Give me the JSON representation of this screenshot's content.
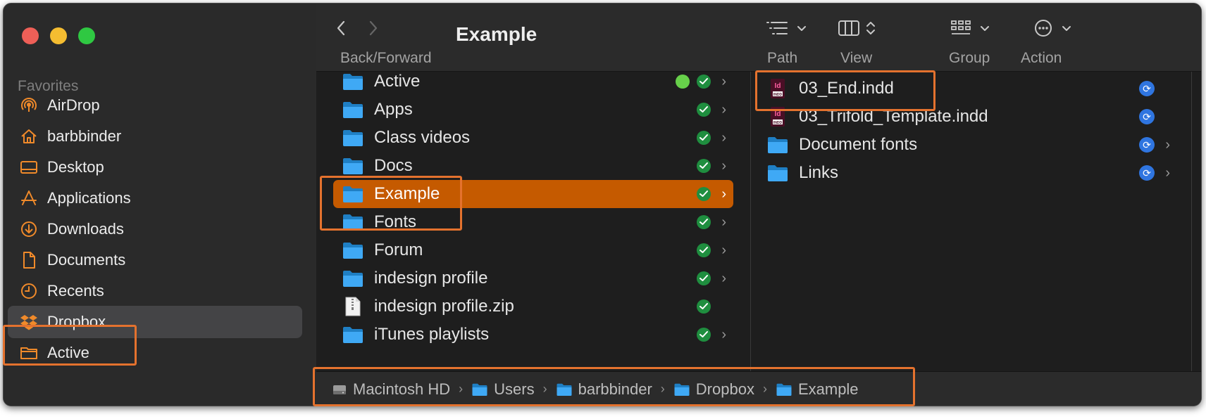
{
  "toolbar": {
    "title": "Example",
    "back_forward_label": "Back/Forward",
    "path_label": "Path",
    "view_label": "View",
    "group_label": "Group",
    "action_label": "Action"
  },
  "sidebar": {
    "section_title": "Favorites",
    "items": [
      {
        "label": "AirDrop",
        "icon": "airdrop-icon"
      },
      {
        "label": "barbbinder",
        "icon": "home-icon"
      },
      {
        "label": "Desktop",
        "icon": "desktop-icon"
      },
      {
        "label": "Applications",
        "icon": "applications-icon"
      },
      {
        "label": "Downloads",
        "icon": "downloads-icon"
      },
      {
        "label": "Documents",
        "icon": "document-icon"
      },
      {
        "label": "Recents",
        "icon": "clock-icon"
      },
      {
        "label": "Dropbox",
        "icon": "dropbox-icon",
        "selected": true
      },
      {
        "label": "Active",
        "icon": "folder-icon"
      }
    ]
  },
  "column1": {
    "items": [
      {
        "label": "Active",
        "type": "folder",
        "status": "synced",
        "green_tag": true
      },
      {
        "label": "Apps",
        "type": "folder",
        "status": "synced"
      },
      {
        "label": "Class videos",
        "type": "folder",
        "status": "synced"
      },
      {
        "label": "Docs",
        "type": "folder",
        "status": "synced"
      },
      {
        "label": "Example",
        "type": "folder",
        "status": "synced",
        "selected": true
      },
      {
        "label": "Fonts",
        "type": "folder",
        "status": "synced"
      },
      {
        "label": "Forum",
        "type": "folder",
        "status": "synced"
      },
      {
        "label": "indesign profile",
        "type": "folder",
        "status": "synced"
      },
      {
        "label": "indesign profile.zip",
        "type": "file",
        "status": "synced"
      },
      {
        "label": "iTunes playlists",
        "type": "folder",
        "status": "synced"
      }
    ]
  },
  "column2": {
    "items": [
      {
        "label": "03_End.indd",
        "type": "indd",
        "status": "syncing"
      },
      {
        "label": "03_Trifold_Template.indd",
        "type": "indd",
        "status": "syncing"
      },
      {
        "label": "Document fonts",
        "type": "folder",
        "status": "syncing"
      },
      {
        "label": "Links",
        "type": "folder",
        "status": "syncing"
      }
    ],
    "indd_icon_text": "Id",
    "indd_icon_subtext": "INDD"
  },
  "pathbar": {
    "segments": [
      "Macintosh HD",
      "Users",
      "barbbinder",
      "Dropbox",
      "Example"
    ]
  },
  "colors": {
    "selection": "#c55a00",
    "highlight": "#e4722e",
    "folder": "#3fa9f5",
    "sync_green": "#1f8e3f",
    "sync_blue": "#2f75e0"
  }
}
